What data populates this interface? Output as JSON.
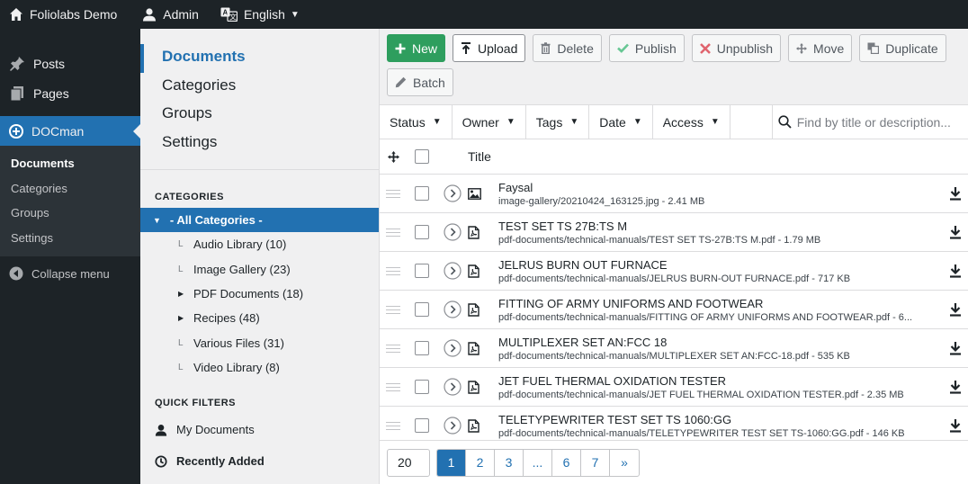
{
  "adminbar": {
    "site_title": "Foliolabs Demo",
    "user": "Admin",
    "language": "English"
  },
  "wpmenu": {
    "items": [
      {
        "label": "Posts",
        "icon": "pushpin-icon"
      },
      {
        "label": "Pages",
        "icon": "pages-icon"
      }
    ],
    "active": {
      "label": "DOCman",
      "icon": "docman-logo-icon"
    },
    "submenu": [
      "Documents",
      "Categories",
      "Groups",
      "Settings"
    ],
    "collapse_label": "Collapse menu"
  },
  "dmnav": {
    "items": [
      "Documents",
      "Categories",
      "Groups",
      "Settings"
    ]
  },
  "categories": {
    "heading": "CATEGORIES",
    "all_label": "- All Categories -",
    "items": [
      {
        "label": "Audio Library (10)",
        "expandable": false
      },
      {
        "label": "Image Gallery (23)",
        "expandable": false
      },
      {
        "label": "PDF Documents (18)",
        "expandable": true
      },
      {
        "label": "Recipes (48)",
        "expandable": true
      },
      {
        "label": "Various Files (31)",
        "expandable": false
      },
      {
        "label": "Video Library (8)",
        "expandable": false
      }
    ]
  },
  "quick_filters": {
    "heading": "QUICK FILTERS",
    "items": [
      "My Documents",
      "Recently Added"
    ]
  },
  "toolbar": {
    "new": "New",
    "upload": "Upload",
    "delete": "Delete",
    "publish": "Publish",
    "unpublish": "Unpublish",
    "move": "Move",
    "duplicate": "Duplicate",
    "batch": "Batch"
  },
  "filters": {
    "status": "Status",
    "owner": "Owner",
    "tags": "Tags",
    "date": "Date",
    "access": "Access",
    "search_placeholder": "Find by title or description..."
  },
  "table": {
    "title_header": "Title",
    "rows": [
      {
        "title": "Faysal",
        "meta": "image-gallery/20210424_163125.jpg - 2.41 MB",
        "type": "image"
      },
      {
        "title": "TEST SET TS 27B:TS M",
        "meta": "pdf-documents/technical-manuals/TEST SET TS-27B:TS M.pdf - 1.79 MB",
        "type": "pdf"
      },
      {
        "title": "JELRUS BURN OUT FURNACE",
        "meta": "pdf-documents/technical-manuals/JELRUS BURN-OUT FURNACE.pdf - 717 KB",
        "type": "pdf"
      },
      {
        "title": "FITTING OF ARMY UNIFORMS AND FOOTWEAR",
        "meta": "pdf-documents/technical-manuals/FITTING OF ARMY UNIFORMS AND FOOTWEAR.pdf - 6...",
        "type": "pdf"
      },
      {
        "title": "MULTIPLEXER SET AN:FCC 18",
        "meta": "pdf-documents/technical-manuals/MULTIPLEXER SET AN:FCC-18.pdf - 535 KB",
        "type": "pdf"
      },
      {
        "title": "JET FUEL THERMAL OXIDATION TESTER",
        "meta": "pdf-documents/technical-manuals/JET FUEL THERMAL OXIDATION TESTER.pdf - 2.35 MB",
        "type": "pdf"
      },
      {
        "title": "TELETYPEWRITER TEST SET TS 1060:GG",
        "meta": "pdf-documents/technical-manuals/TELETYPEWRITER TEST SET TS-1060:GG.pdf - 146 KB",
        "type": "pdf"
      }
    ]
  },
  "pagination": {
    "limit": "20",
    "pages": [
      "1",
      "2",
      "3",
      "...",
      "6",
      "7",
      "»"
    ],
    "current": "1"
  }
}
